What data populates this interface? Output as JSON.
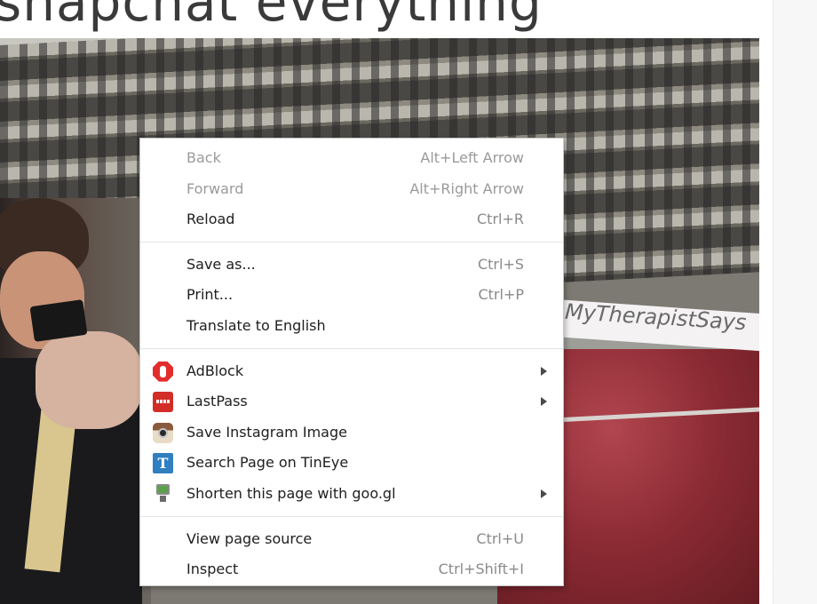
{
  "page": {
    "header_text": "snapchat everything"
  },
  "photo": {
    "watermark": "MyTherapistSays"
  },
  "context_menu": {
    "groups": [
      [
        {
          "label": "Back",
          "shortcut": "Alt+Left Arrow",
          "disabled": true
        },
        {
          "label": "Forward",
          "shortcut": "Alt+Right Arrow",
          "disabled": true
        },
        {
          "label": "Reload",
          "shortcut": "Ctrl+R",
          "disabled": false
        }
      ],
      [
        {
          "label": "Save as...",
          "shortcut": "Ctrl+S",
          "disabled": false
        },
        {
          "label": "Print...",
          "shortcut": "Ctrl+P",
          "disabled": false
        },
        {
          "label": "Translate to English",
          "shortcut": "",
          "disabled": false
        }
      ],
      [
        {
          "label": "AdBlock",
          "icon": "adblock-icon",
          "submenu": true
        },
        {
          "label": "LastPass",
          "icon": "lastpass-icon",
          "submenu": true
        },
        {
          "label": "Save Instagram Image",
          "icon": "instagram-camera-icon",
          "submenu": false
        },
        {
          "label": "Search Page on TinEye",
          "icon": "tineye-icon",
          "icon_glyph": "T",
          "submenu": false
        },
        {
          "label": "Shorten this page with goo.gl",
          "icon": "googl-monitor-icon",
          "submenu": true
        }
      ],
      [
        {
          "label": "View page source",
          "shortcut": "Ctrl+U",
          "disabled": false
        },
        {
          "label": "Inspect",
          "shortcut": "Ctrl+Shift+I",
          "disabled": false
        }
      ]
    ],
    "colors": {
      "adblock": "#e32d2d",
      "lastpass": "#d32d27",
      "tineye": "#2f7fc1",
      "disabled_text": "#9a9a9a",
      "shortcut_text": "#8a8a8a"
    }
  }
}
